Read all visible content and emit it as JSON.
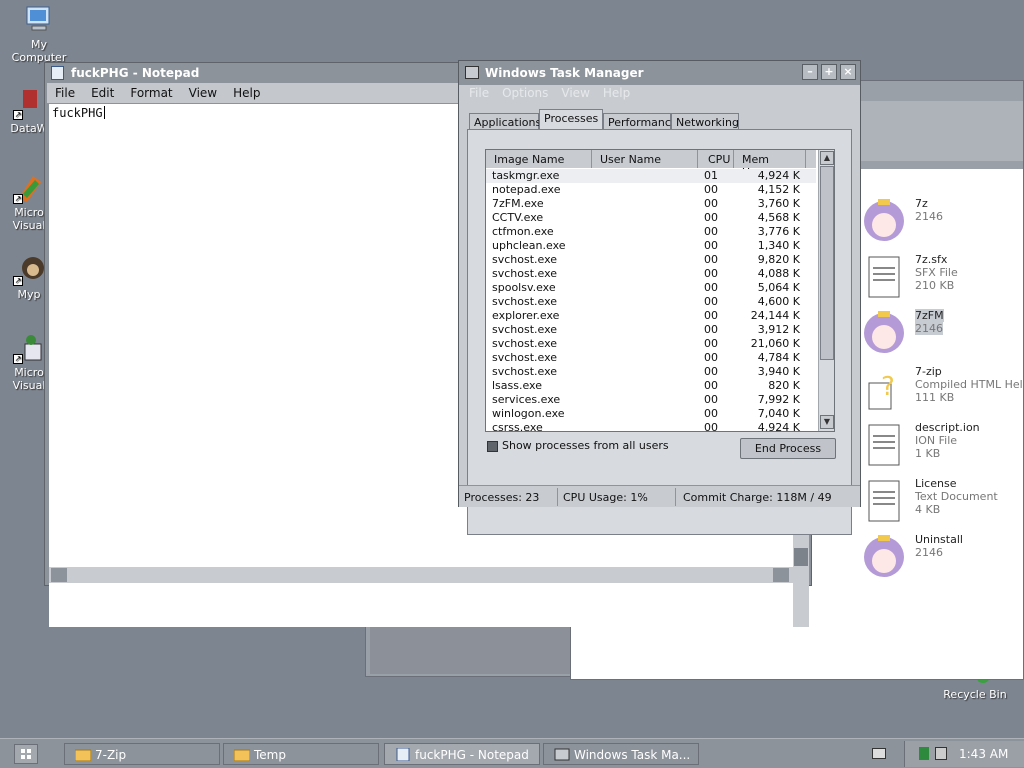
{
  "desktop": {
    "icons": [
      {
        "label": "My\nComputer"
      },
      {
        "label": "DataW"
      },
      {
        "label": "Micro\nVisual"
      },
      {
        "label": "Myp"
      },
      {
        "label": "Micro\nVisual"
      },
      {
        "label": "Recycle Bin"
      }
    ]
  },
  "explorer": {
    "files": [
      {
        "name": "7z",
        "line1": "2146",
        "line2": ""
      },
      {
        "name": "7z.sfx",
        "line1": "SFX File",
        "line2": "210 KB"
      },
      {
        "name": "7zFM",
        "line1": "2146",
        "line2": ""
      },
      {
        "name": "7-zip",
        "line1": "Compiled HTML Hel",
        "line2": "111 KB"
      },
      {
        "name": "descript.ion",
        "line1": "ION File",
        "line2": "1 KB"
      },
      {
        "name": "License",
        "line1": "Text Document",
        "line2": "4 KB"
      },
      {
        "name": "Uninstall",
        "line1": "2146",
        "line2": ""
      }
    ]
  },
  "notepad": {
    "title": "fuckPHG - Notepad",
    "menu": [
      "File",
      "Edit",
      "Format",
      "View",
      "Help"
    ],
    "content": "fuckPHG"
  },
  "taskmgr": {
    "title": "Windows Task Manager",
    "menu": [
      "File",
      "Options",
      "View",
      "Help"
    ],
    "buttons": {
      "minimize": "–",
      "maximize": "+",
      "close": "×"
    },
    "tabs": [
      "Applications",
      "Processes",
      "Performance",
      "Networking"
    ],
    "active_tab": "Processes",
    "columns": [
      "Image Name",
      "User Name",
      "CPU",
      "Mem Usage"
    ],
    "processes": [
      {
        "name": "taskmgr.exe",
        "cpu": "01",
        "mem": "4,924 K"
      },
      {
        "name": "notepad.exe",
        "cpu": "00",
        "mem": "4,152 K"
      },
      {
        "name": "7zFM.exe",
        "cpu": "00",
        "mem": "3,760 K"
      },
      {
        "name": "CCTV.exe",
        "cpu": "00",
        "mem": "4,568 K"
      },
      {
        "name": "ctfmon.exe",
        "cpu": "00",
        "mem": "3,776 K"
      },
      {
        "name": "uphclean.exe",
        "cpu": "00",
        "mem": "1,340 K"
      },
      {
        "name": "svchost.exe",
        "cpu": "00",
        "mem": "9,820 K"
      },
      {
        "name": "svchost.exe",
        "cpu": "00",
        "mem": "4,088 K"
      },
      {
        "name": "spoolsv.exe",
        "cpu": "00",
        "mem": "5,064 K"
      },
      {
        "name": "svchost.exe",
        "cpu": "00",
        "mem": "4,600 K"
      },
      {
        "name": "explorer.exe",
        "cpu": "00",
        "mem": "24,144 K"
      },
      {
        "name": "svchost.exe",
        "cpu": "00",
        "mem": "3,912 K"
      },
      {
        "name": "svchost.exe",
        "cpu": "00",
        "mem": "21,060 K"
      },
      {
        "name": "svchost.exe",
        "cpu": "00",
        "mem": "4,784 K"
      },
      {
        "name": "svchost.exe",
        "cpu": "00",
        "mem": "3,940 K"
      },
      {
        "name": "lsass.exe",
        "cpu": "00",
        "mem": "820 K"
      },
      {
        "name": "services.exe",
        "cpu": "00",
        "mem": "7,992 K"
      },
      {
        "name": "winlogon.exe",
        "cpu": "00",
        "mem": "7,040 K"
      },
      {
        "name": "csrss.exe",
        "cpu": "00",
        "mem": "4,924 K"
      }
    ],
    "show_all_label": "Show processes from all users",
    "end_process_label": "End Process",
    "status": {
      "processes": "Processes: 23",
      "cpu": "CPU Usage: 1%",
      "commit": "Commit Charge: 118M / 49"
    }
  },
  "taskbar": {
    "items": [
      {
        "label": "7-Zip",
        "icon": "folder-icon"
      },
      {
        "label": "Temp",
        "icon": "folder-icon"
      },
      {
        "label": "fuckPHG - Notepad",
        "icon": "notepad-icon"
      },
      {
        "label": "Windows Task Ma...",
        "icon": "taskmgr-icon"
      }
    ],
    "clock": "1:43 AM"
  }
}
